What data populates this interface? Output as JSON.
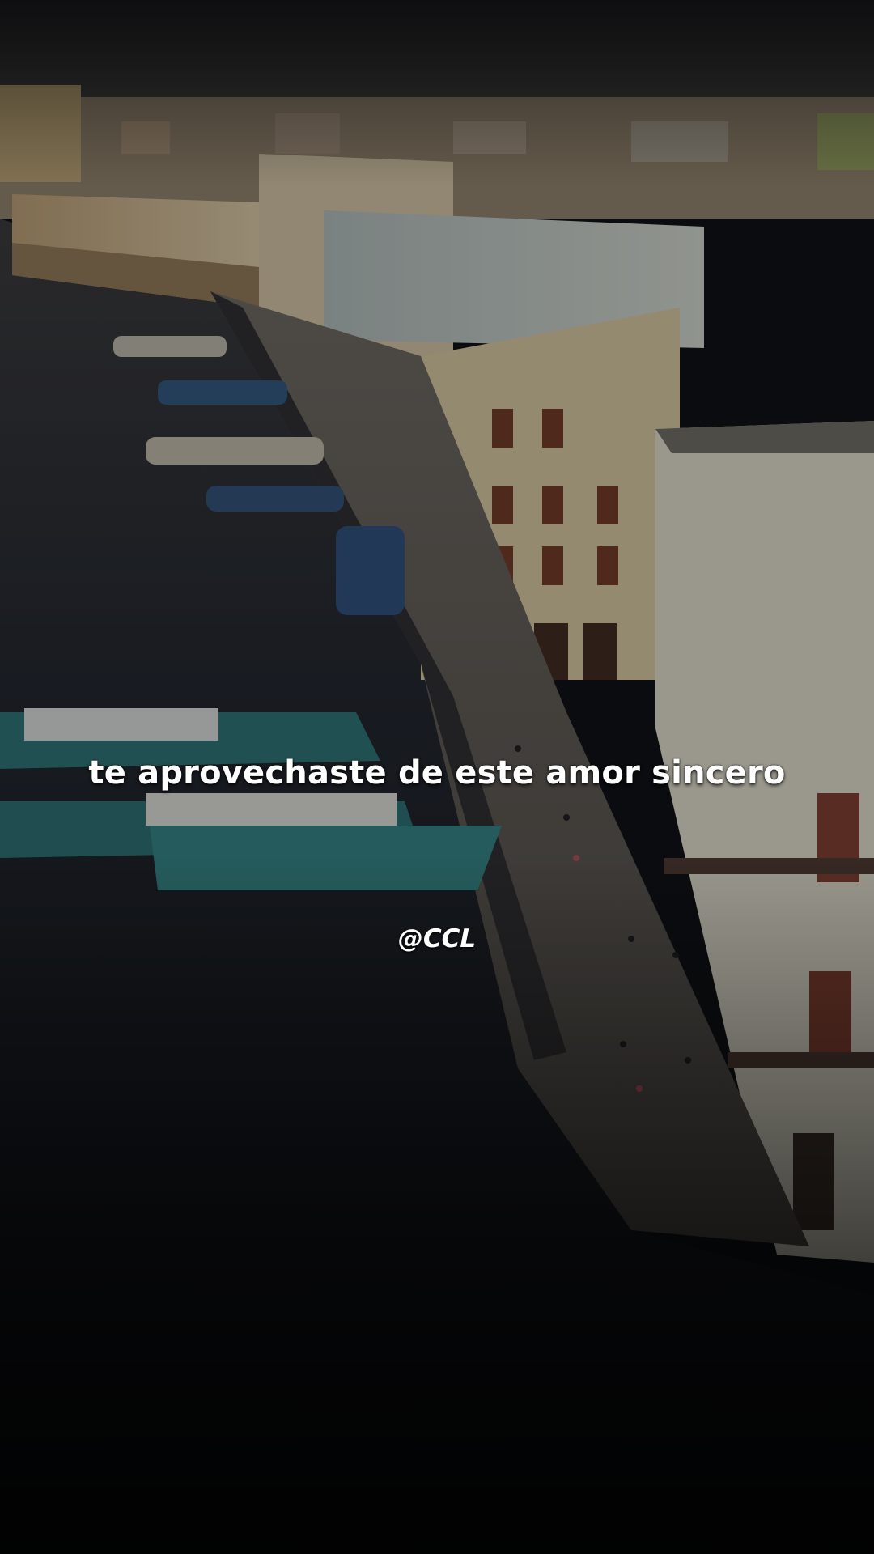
{
  "overlay": {
    "lyric": "te aprovechaste de este amor sincero",
    "watermark": "@CCL"
  },
  "scene": {
    "description_icon": "waterfront-city-photo",
    "colors": {
      "sky": "#3a3a40",
      "water": "#1b1f27",
      "buildings_warm": "#b8a27c",
      "buildings_cool": "#9aa8ad",
      "promenade": "#5f5b57",
      "boat_teal": "#2f6f72",
      "boat_blue": "#33557a"
    }
  }
}
